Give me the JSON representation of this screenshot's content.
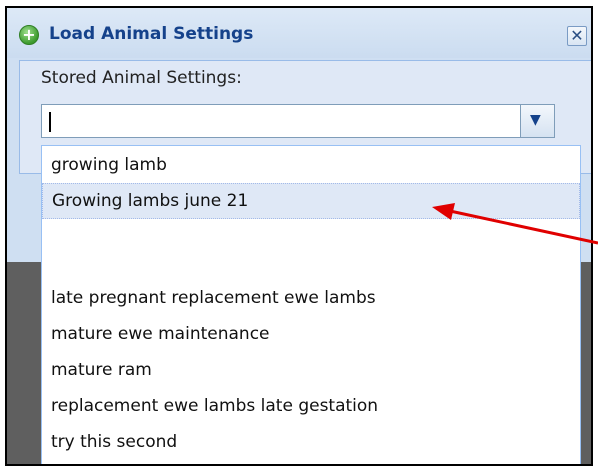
{
  "dialog": {
    "title": "Load Animal Settings",
    "add_icon": "plus-circle-icon",
    "close_icon": "close-icon",
    "close_glyph": "✕"
  },
  "form": {
    "label": "Stored Animal Settings:",
    "combo_value": "",
    "trigger_icon": "chevron-down-icon",
    "trigger_glyph": "▼"
  },
  "dropdown": {
    "items": [
      "growing lamb",
      "Growing lambs june 21",
      "",
      "late pregnant replacement ewe lambs",
      "mature ewe maintenance",
      "mature ram",
      "replacement ewe lambs late gestation",
      "try this second"
    ],
    "selected_index": 1
  },
  "annotation": {
    "arrow_color": "#e00000"
  },
  "colors": {
    "title_text": "#15428b",
    "window_bg": "#cfdff2",
    "selected_bg": "#dfe8f6",
    "backdrop": "#5f5f5f"
  }
}
